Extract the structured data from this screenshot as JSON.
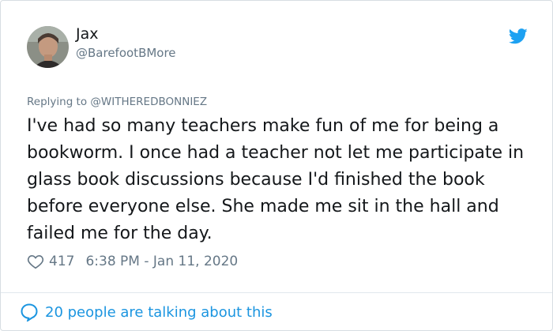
{
  "tweet": {
    "author_name": "Jax",
    "author_handle": "@BarefootBMore",
    "replying_prefix": "Replying to",
    "replying_to": "@WITHEREDBONNIEZ",
    "text": "I've had so many teachers make fun of me for being a bookworm. I once had a teacher not let me participate in glass book discussions because I'd finished the book before everyone else. She made me sit in the hall and failed me for the day.",
    "likes": "417",
    "timestamp": "6:38 PM - Jan 11, 2020"
  },
  "footer": {
    "talking_label": "20 people are talking about this"
  },
  "icons": {
    "brand": "twitter-bird-icon",
    "like": "heart-icon",
    "conversation": "speech-bubble-icon"
  },
  "colors": {
    "brand_blue": "#1da1f2",
    "link_blue": "#1b95e0",
    "text": "#14171a",
    "muted": "#657786"
  }
}
